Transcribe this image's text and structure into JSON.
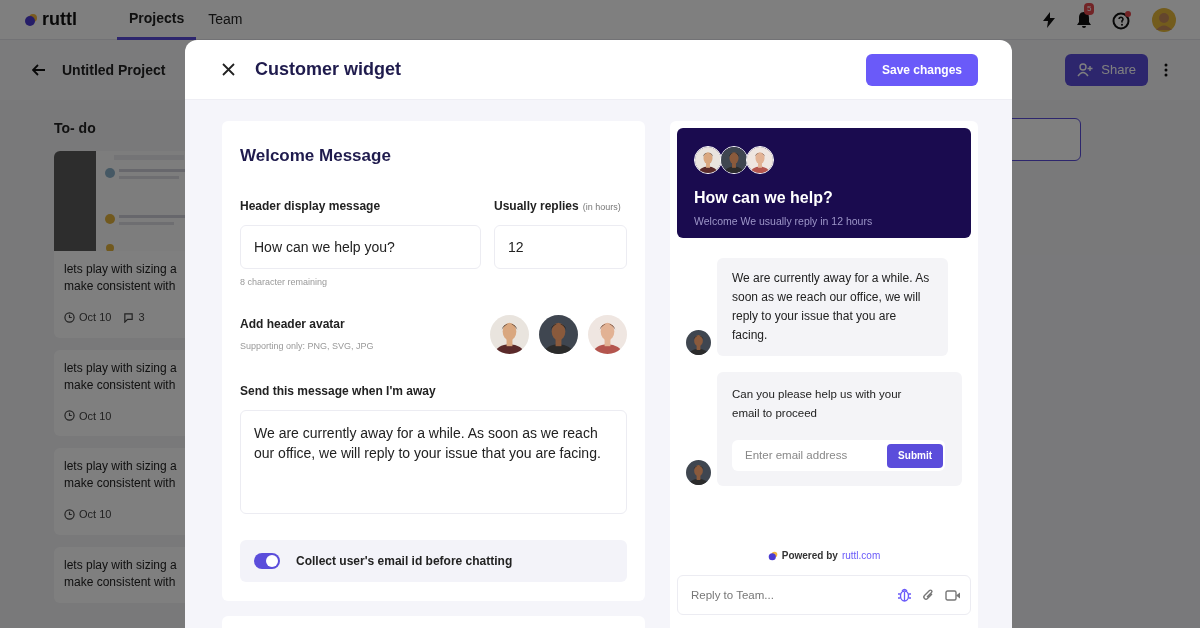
{
  "app": {
    "logo": "ruttl",
    "nav_tabs": [
      {
        "label": "Projects",
        "selected": true
      },
      {
        "label": "Team",
        "selected": false
      }
    ],
    "notification_count": "5",
    "project_title": "Untitled Project",
    "share_button": "Share"
  },
  "board": {
    "column_title": "To- do",
    "cards": [
      {
        "text": "lets play with sizing a\nmake consistent with",
        "thumbnail": true,
        "date": "Oct 10",
        "comments": "3"
      },
      {
        "text": "lets play with sizing a\nmake consistent with",
        "thumbnail": false,
        "date": "Oct 10"
      },
      {
        "text": "lets play with sizing a\nmake consistent with",
        "thumbnail": false,
        "date": "Oct 10"
      },
      {
        "text": "lets play with sizing a\nmake consistent with",
        "thumbnail": false
      }
    ]
  },
  "modal": {
    "title": "Customer widget",
    "save_button": "Save changes",
    "welcome": {
      "title": "Welcome Message",
      "header_label": "Header display message",
      "header_value": "How can we help you?",
      "char_hint": "8 character remaining",
      "replies_label": "Usually replies",
      "replies_unit": "(in hours)",
      "replies_value": "12",
      "avatar_label": "Add header avatar",
      "avatar_hint": "Supporting only: PNG, SVG, JPG",
      "away_label": "Send this message when I'm away",
      "away_value": "We are currently away for a while. As soon as we reach our office, we will reply to your issue that you are facing.",
      "collect_toggle": {
        "label": "Collect user's email id before chatting",
        "on": true
      }
    },
    "preview": {
      "title": "How can we help?",
      "subtitle": "Welcome We usually reply in 12 hours",
      "messages": [
        {
          "kind": "text",
          "text": "We are currently away for a while. As soon as we reach our office, we will reply to your issue that you are facing."
        },
        {
          "kind": "email_form",
          "text": "Can you please help us with your email to proceed",
          "placeholder": "Enter email address",
          "button": "Submit"
        }
      ],
      "powered_by": "Powered by",
      "powered_link": "ruttl.com",
      "reply_placeholder": "Reply to Team..."
    }
  }
}
